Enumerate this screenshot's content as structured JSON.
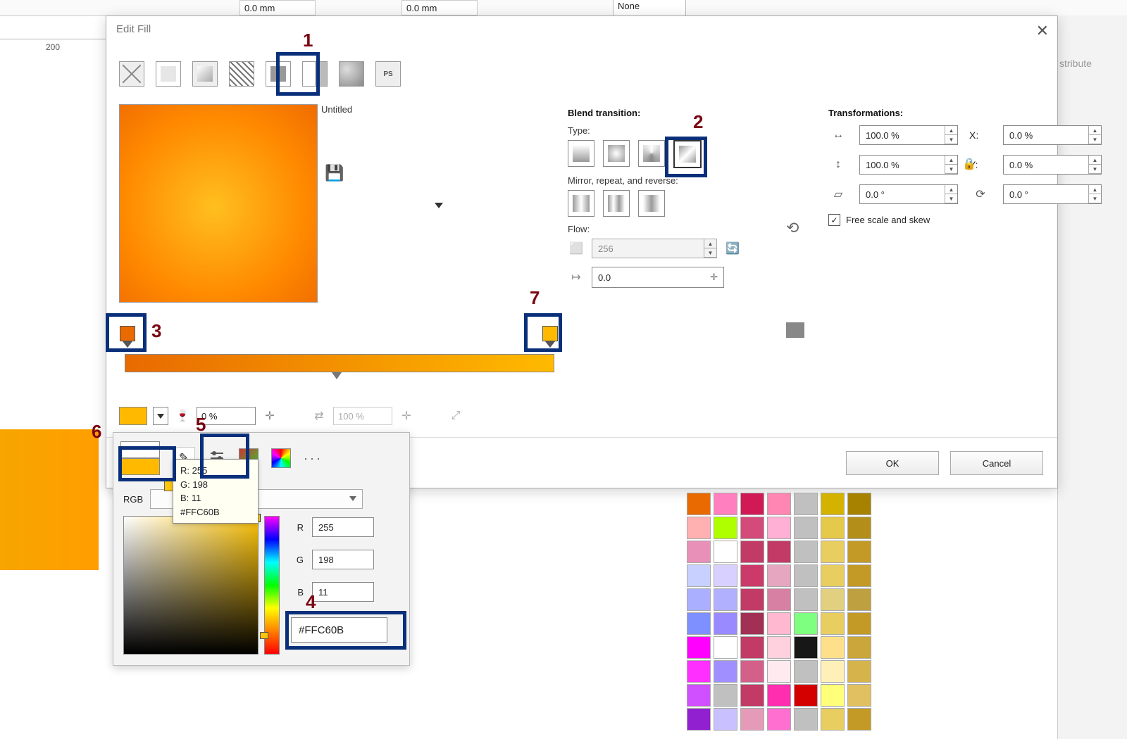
{
  "toolbar": {
    "mm_value_1": "0.0 mm",
    "mm_value_2": "0.0 mm",
    "none_label": "None"
  },
  "ruler": {
    "mark": "200"
  },
  "dialog": {
    "title": "Edit Fill",
    "close": "✕",
    "preview_name": "Untitled",
    "blend": {
      "section": "Blend transition:",
      "type_label": "Type:",
      "mirror_label": "Mirror, repeat, and reverse:",
      "flow_label": "Flow:",
      "flow_steps": "256",
      "position": "0.0"
    },
    "transparency": {
      "value": "0 %",
      "merge": "100 %"
    },
    "transform": {
      "section": "Transformations:",
      "w": "100.0 %",
      "h": "100.0 %",
      "x": "0.0 %",
      "y": "0.0 %",
      "skew": "0.0 °",
      "rot": "0.0 °",
      "x_label": "X:",
      "y_label": "Y:",
      "free": "Free scale and skew"
    },
    "ok": "OK",
    "cancel": "Cancel"
  },
  "color_popup": {
    "model_label": "RGB",
    "r_label": "R",
    "g_label": "G",
    "b_label": "B",
    "r": "255",
    "g": "198",
    "b": "11",
    "hex": "#FFC60B",
    "tooltip": {
      "r": "R: 255",
      "g": "G: 198",
      "b": "B: 11",
      "hex": "#FFC60B"
    }
  },
  "annotations": {
    "n1": "1",
    "n2": "2",
    "n3": "3",
    "n4": "4",
    "n5": "5",
    "n6": "6",
    "n7": "7"
  },
  "side_panel": {
    "partial": "stribute"
  },
  "palette_colors": [
    [
      "#e86a00",
      "#ff7fbf",
      "#d11a55",
      "#ff85b2",
      "#c0c0c0",
      "#d4b300",
      "#a68200"
    ],
    [
      "#ffb0b0",
      "#b0ff00",
      "#d44a7a",
      "#ffb0d4",
      "#c0c0c0",
      "#e5c94a",
      "#b38f1a"
    ],
    [
      "#e890b8",
      "#ffffff",
      "#c23a66",
      "#c23a66",
      "#c0c0c0",
      "#e8cd60",
      "#c49a26"
    ],
    [
      "#c7d0ff",
      "#d8d0ff",
      "#cc3a6a",
      "#e6a6c0",
      "#c0c0c0",
      "#e8cd60",
      "#c49a26"
    ],
    [
      "#aab0ff",
      "#b0b0ff",
      "#c23a66",
      "#d680a4",
      "#c0c0c0",
      "#e0d080",
      "#bfa040"
    ],
    [
      "#7e90ff",
      "#9a8aff",
      "#a23055",
      "#ffb8d0",
      "#7fff7f",
      "#e8cd60",
      "#c49a26"
    ],
    [
      "#ff00ff",
      "#ffffff",
      "#c23a66",
      "#ffd0de",
      "#171717",
      "#ffe08a",
      "#cba63a"
    ],
    [
      "#ff30ff",
      "#a090ff",
      "#d4608a",
      "#ffeaf0",
      "#c0c0c0",
      "#fff0b8",
      "#d6b44c"
    ],
    [
      "#d050ff",
      "#c0c0c0",
      "#c23a66",
      "#ff2fb0",
      "#d40000",
      "#ffff7a",
      "#e0c060"
    ],
    [
      "#9020d0",
      "#c8c0ff",
      "#e59ab8",
      "#ff6fd0",
      "#c0c0c0",
      "#e8cd60",
      "#c49a26"
    ]
  ]
}
